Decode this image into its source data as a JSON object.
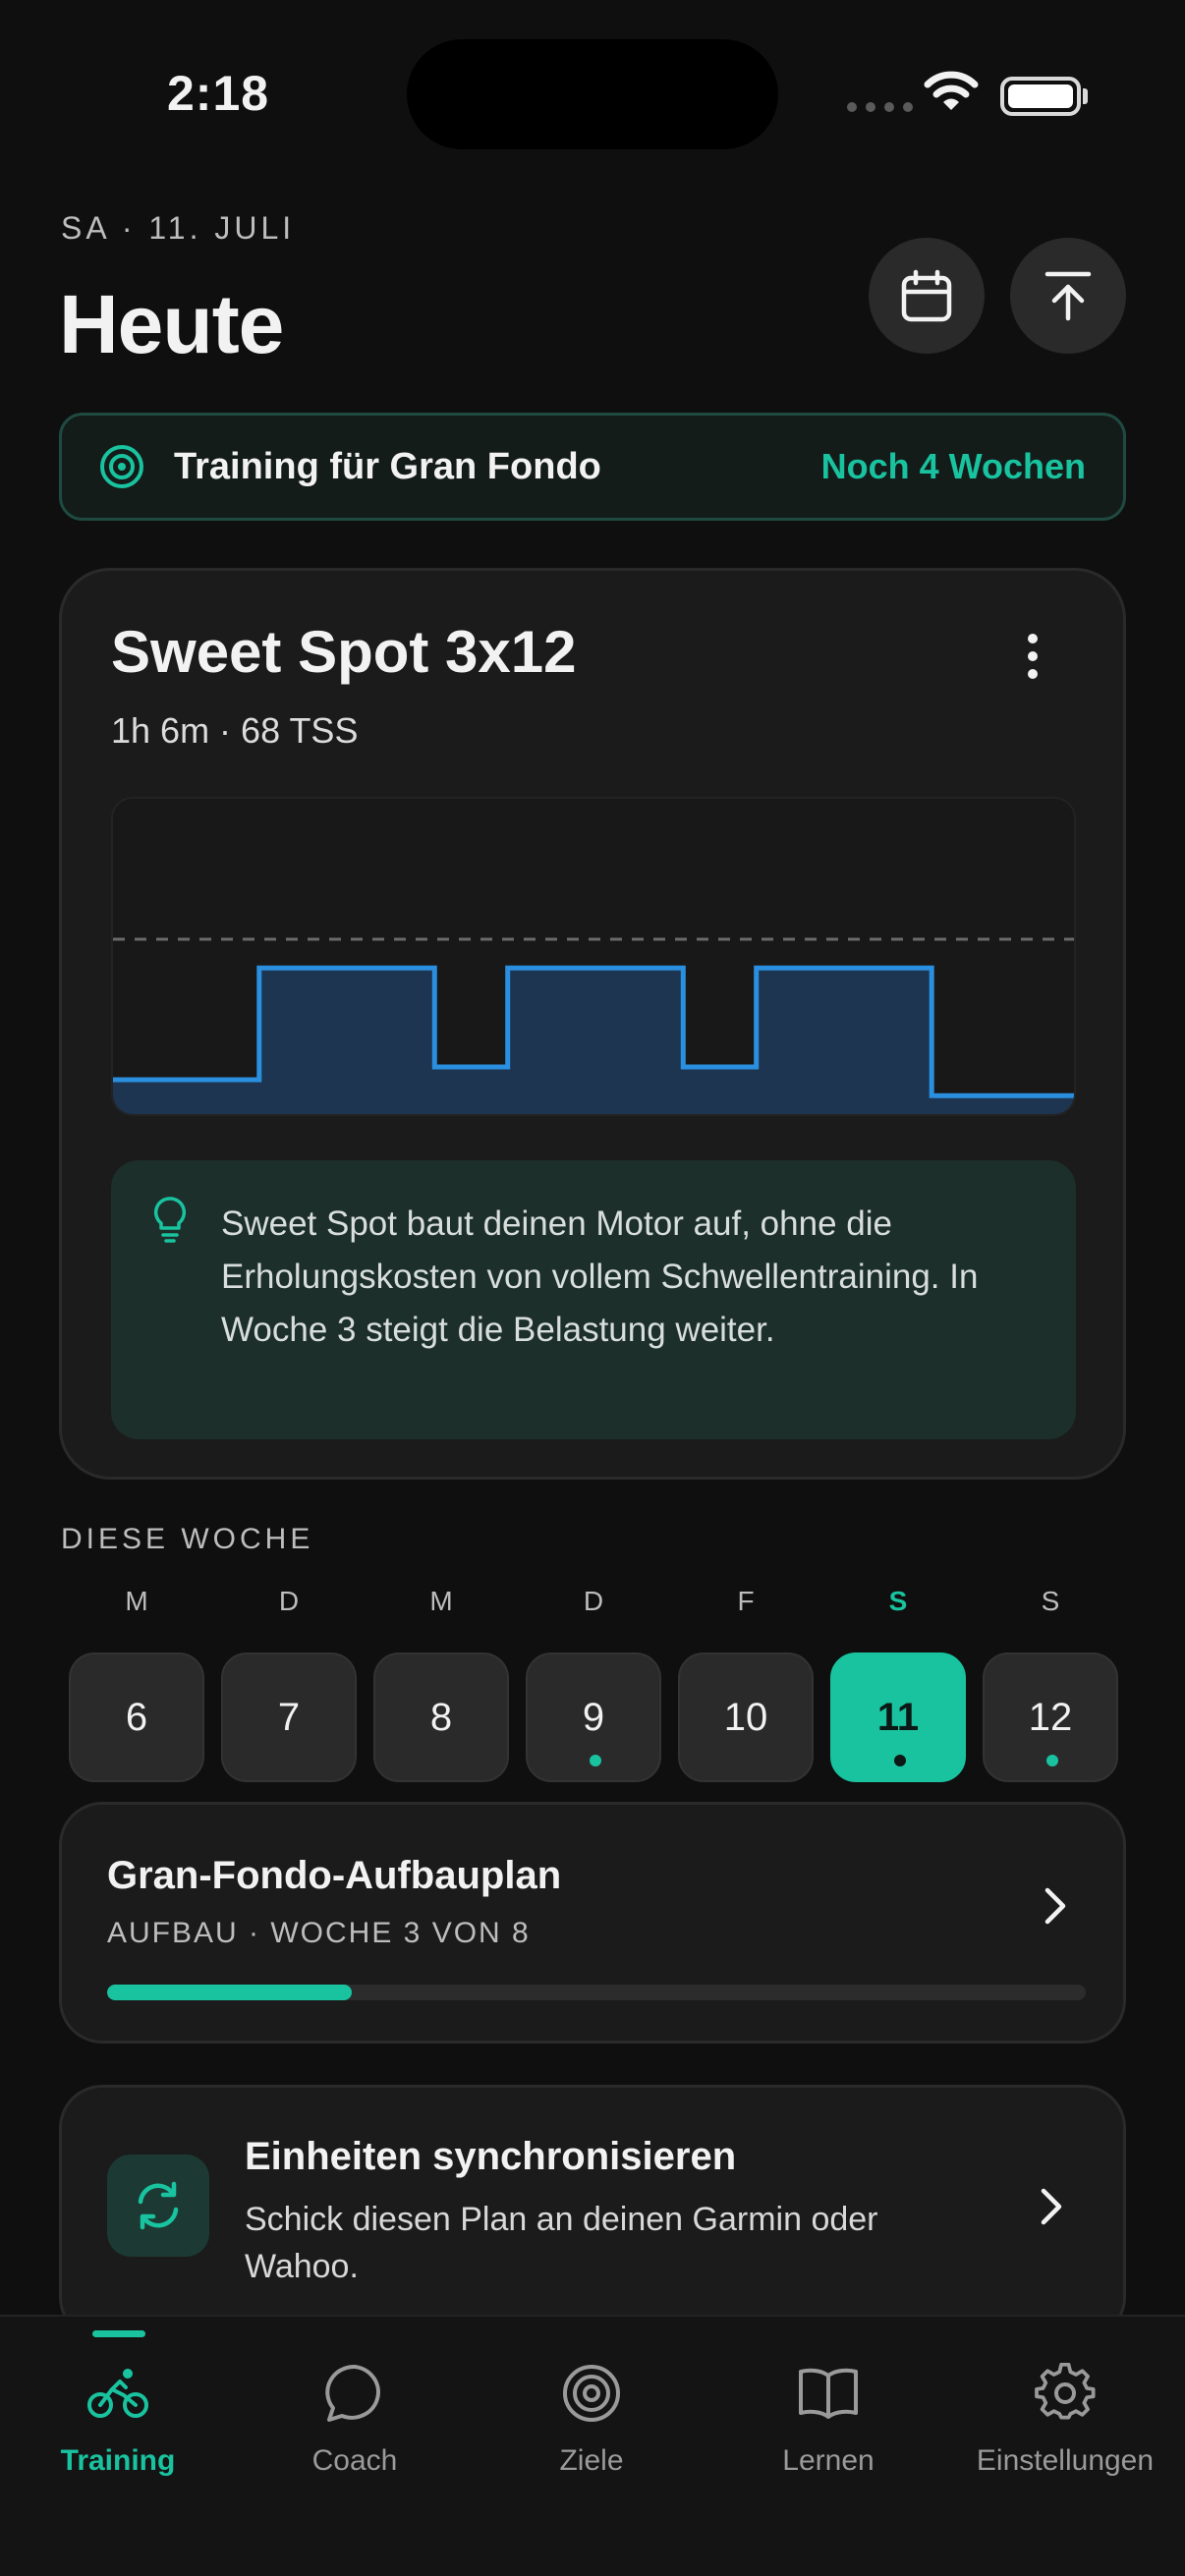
{
  "status_bar": {
    "time": "2:18"
  },
  "header": {
    "date": "SA · 11. JULI",
    "title": "Heute"
  },
  "goal_banner": {
    "text": "Training für Gran Fondo",
    "remaining": "Noch 4 Wochen"
  },
  "workout": {
    "name": "Sweet Spot 3x12",
    "meta": "1h 6m · 68 TSS",
    "tip": "Sweet Spot baut deinen Motor auf, ohne die Erholungskosten von vollem Schwellentraining. In Woche 3 steigt die Belastung weiter."
  },
  "chart_data": {
    "type": "area",
    "series": [
      {
        "segments": [
          {
            "duration": 15,
            "level": 0.12
          },
          {
            "duration": 18,
            "level": 0.47
          },
          {
            "duration": 7.5,
            "level": 0.16
          },
          {
            "duration": 18,
            "level": 0.47
          },
          {
            "duration": 7.5,
            "level": 0.16
          },
          {
            "duration": 18,
            "level": 0.47
          },
          {
            "duration": 15,
            "level": 0.07
          }
        ]
      }
    ],
    "reference_line": 0.56,
    "colors": {
      "line": "#2b8fe0",
      "fill": "#1d3550",
      "reference": "#6a6a6a"
    }
  },
  "week": {
    "label": "DIESE WOCHE",
    "days": [
      {
        "letter": "M",
        "number": "6",
        "dot": false,
        "active": false
      },
      {
        "letter": "D",
        "number": "7",
        "dot": false,
        "active": false
      },
      {
        "letter": "M",
        "number": "8",
        "dot": false,
        "active": false
      },
      {
        "letter": "D",
        "number": "9",
        "dot": true,
        "active": false
      },
      {
        "letter": "F",
        "number": "10",
        "dot": false,
        "active": false
      },
      {
        "letter": "S",
        "number": "11",
        "dot": true,
        "active": true
      },
      {
        "letter": "S",
        "number": "12",
        "dot": true,
        "active": false
      }
    ]
  },
  "plan": {
    "title": "Gran-Fondo-Aufbauplan",
    "subtitle": "AUFBAU · WOCHE 3 VON 8",
    "progress": 0.25
  },
  "sync": {
    "title": "Einheiten synchronisieren",
    "text": "Schick diesen Plan an deinen Garmin oder Wahoo."
  },
  "tabs": [
    {
      "label": "Training",
      "icon": "bike-icon",
      "active": true
    },
    {
      "label": "Coach",
      "icon": "chat-bubble-icon",
      "active": false
    },
    {
      "label": "Ziele",
      "icon": "target-icon",
      "active": false
    },
    {
      "label": "Lernen",
      "icon": "book-icon",
      "active": false
    },
    {
      "label": "Einstellungen",
      "icon": "gear-icon",
      "active": false
    }
  ],
  "colors": {
    "accent": "#19c39f",
    "background": "#0f0f0f",
    "card": "#1b1b1b"
  }
}
